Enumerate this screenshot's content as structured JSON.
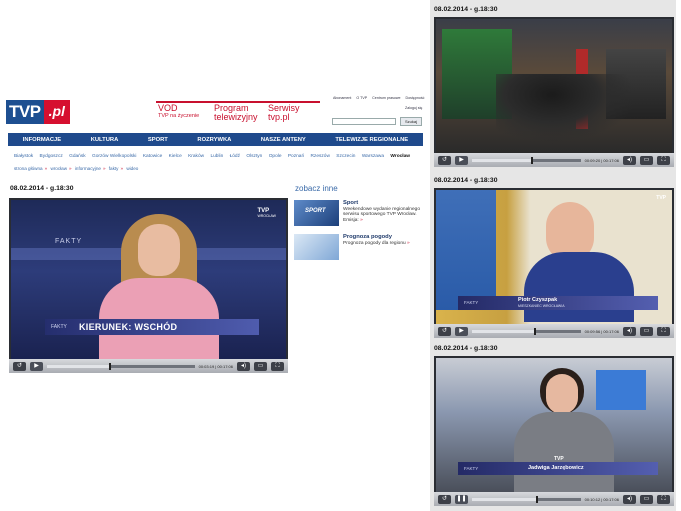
{
  "header": {
    "logo_tvp": "TVP",
    "logo_pl": ".pl",
    "promos": [
      {
        "title": "VOD",
        "sub": "TVP na życzenie"
      },
      {
        "title": "Program",
        "sub": "telewizyjny"
      },
      {
        "title": "Serwisy",
        "sub": "tvp.pl"
      }
    ],
    "toplinks": [
      "Abonament",
      "O TVP",
      "Centrum prasowe",
      "Dostępność"
    ],
    "login": "Zaloguj się",
    "search_button": "Szukaj"
  },
  "nav": [
    "INFORMACJE",
    "KULTURA",
    "SPORT",
    "ROZRYWKA",
    "NASZE ANTENY",
    "TELEWIZJE REGIONALNE"
  ],
  "cities": [
    "Białystok",
    "Bydgoszcz",
    "Gdańsk",
    "Gorzów Wielkopolski",
    "Katowice",
    "Kielce",
    "Kraków",
    "Lublin",
    "Łódź",
    "Olsztyn",
    "Opole",
    "Poznań",
    "Rzeszów",
    "Szczecin",
    "Warszawa",
    "Wrocław"
  ],
  "active_city": "Wrocław",
  "breadcrumbs": [
    "strona główna",
    "wrocław",
    "informacyjne",
    "fakty",
    "wideo"
  ],
  "main": {
    "date_title": "08.02.2014 - g.18:30",
    "headline": "KIERUNEK: WSCHÓD",
    "fakty": "FAKTY",
    "bug": "TVP",
    "bug_sub": "WROCŁAW",
    "time": "00:03:19 | 00:17:06",
    "progress": 0.42
  },
  "zobacz": {
    "title": "zobacz inne",
    "items": [
      {
        "title": "Sport",
        "text": "Weekendowe wydanie regionalnego serwisu sportowego TVP Wrocław. Emisja:",
        "more": "»"
      },
      {
        "title": "Prognoza pogody",
        "text": "Prognoza pogody dla regionu",
        "more": "»"
      }
    ]
  },
  "right": [
    {
      "date": "08.02.2014 - g.18:30",
      "time": "00:09:20 | 00:17:06",
      "progress": 0.54
    },
    {
      "date": "08.02.2014 - g.18:30",
      "name": "Piotr Czyszpak",
      "role": "MIESZKANIEC WROCŁAWIA",
      "fakty": "FAKTY",
      "bug": "TVP",
      "time": "00:09:56 | 00:17:06",
      "progress": 0.57
    },
    {
      "date": "08.02.2014 - g.18:30",
      "name": "Jadwiga Jarzębowicz",
      "fakty": "FAKTY",
      "bug": "TVP",
      "time": "00:10:12 | 00:17:06",
      "progress": 0.59
    }
  ]
}
